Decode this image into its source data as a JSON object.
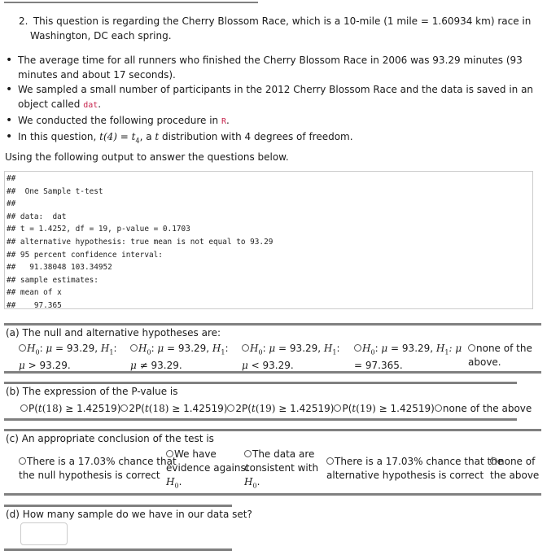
{
  "question": {
    "number": "2.",
    "intro_line1": "This question is regarding the Cherry Blossom Race, which is a 10-mile (1 mile = 1.60934 km) race in",
    "intro_line2": "Washington, DC each spring."
  },
  "bullets": [
    {
      "text": "The average time for all runners who finished the Cherry Blossom Race in 2006 was 93.29 minutes (93 minutes and about 17 seconds)."
    },
    {
      "text_before": "We sampled a small number of participants in the 2012 Cherry Blossom Race and the data is saved in an object called ",
      "code": "dat",
      "text_after": "."
    },
    {
      "text_before": "We conducted the following procedure in ",
      "code": "R",
      "text_after": "."
    },
    {
      "text_before": "In this question, ",
      "math1": "t(4) = t",
      "math1_sub": "4",
      "text_mid": ", a ",
      "math2": "t",
      "text_after": " distribution with 4 degrees of freedom."
    }
  ],
  "using_text": "Using the following output to answer the questions below.",
  "r_output": [
    "##",
    "##  One Sample t-test",
    "##",
    "## data:  dat",
    "## t = 1.4252, df = 19, p-value = 0.1703",
    "## alternative hypothesis: true mean is not equal to 93.29",
    "## 95 percent confidence interval:",
    "##   91.38048 103.34952",
    "## sample estimates:",
    "## mean of x",
    "##    97.365"
  ],
  "part_a": {
    "label": "(a) The null and alternative hypotheses are:",
    "options": [
      {
        "h0": "H",
        "h0_sub": "0",
        "mu": "μ",
        "eq": " = 93.29, ",
        "h1": "H",
        "h1_sub": "1",
        "line2_mu": "μ",
        "line2_rest": " > 93.29."
      },
      {
        "h0": "H",
        "h0_sub": "0",
        "mu": "μ",
        "eq": " = 93.29, ",
        "h1": "H",
        "h1_sub": "1",
        "line2_mu": "μ",
        "line2_rest": " ≠ 93.29."
      },
      {
        "h0": "H",
        "h0_sub": "0",
        "mu": "μ",
        "eq": " = 93.29, ",
        "h1": "H",
        "h1_sub": "1",
        "line2_mu": "μ",
        "line2_rest": " < 93.29."
      },
      {
        "h0": "H",
        "h0_sub": "0",
        "mu": "μ",
        "eq": " = 93.29, ",
        "h1": "H",
        "h1_sub": "1",
        "line1_tail": ": μ",
        "line2_rest": "= 97.365."
      },
      {
        "line1": "none of the",
        "line2": "above."
      }
    ]
  },
  "part_b": {
    "label": "(b) The expression of the P-value is",
    "options": [
      {
        "prefix": "P(",
        "t": "t",
        "df": "(18)",
        "rest": " ≥ 1.42519)"
      },
      {
        "prefix": "2P(",
        "t": "t",
        "df": "(18)",
        "rest": " ≥ 1.42519)"
      },
      {
        "prefix": "2P(",
        "t": "t",
        "df": "(19)",
        "rest": " ≥ 1.42519)"
      },
      {
        "prefix": "P(",
        "t": "t",
        "df": "(19)",
        "rest": " ≥ 1.42519)"
      },
      {
        "text": "none of the above"
      }
    ]
  },
  "part_c": {
    "label": "(c) An appropriate conclusion of the test is",
    "options": [
      {
        "line1": "There is a 17.03% chance that",
        "line2": "the null hypothesis is correct"
      },
      {
        "line1": "We have",
        "line2": "evidence against",
        "line3": "H",
        "line3_sub": "0",
        "line3_tail": "."
      },
      {
        "line1": "The data are",
        "line2": "consistent with",
        "line3": "H",
        "line3_sub": "0",
        "line3_tail": "."
      },
      {
        "line1": "There is a 17.03% chance that the",
        "line2": "alternative hypothesis is correct"
      },
      {
        "line1": "none of",
        "line2": "the above"
      }
    ]
  },
  "part_d": {
    "label": "(d) How many sample do we have in our data set?",
    "answer_value": ""
  }
}
